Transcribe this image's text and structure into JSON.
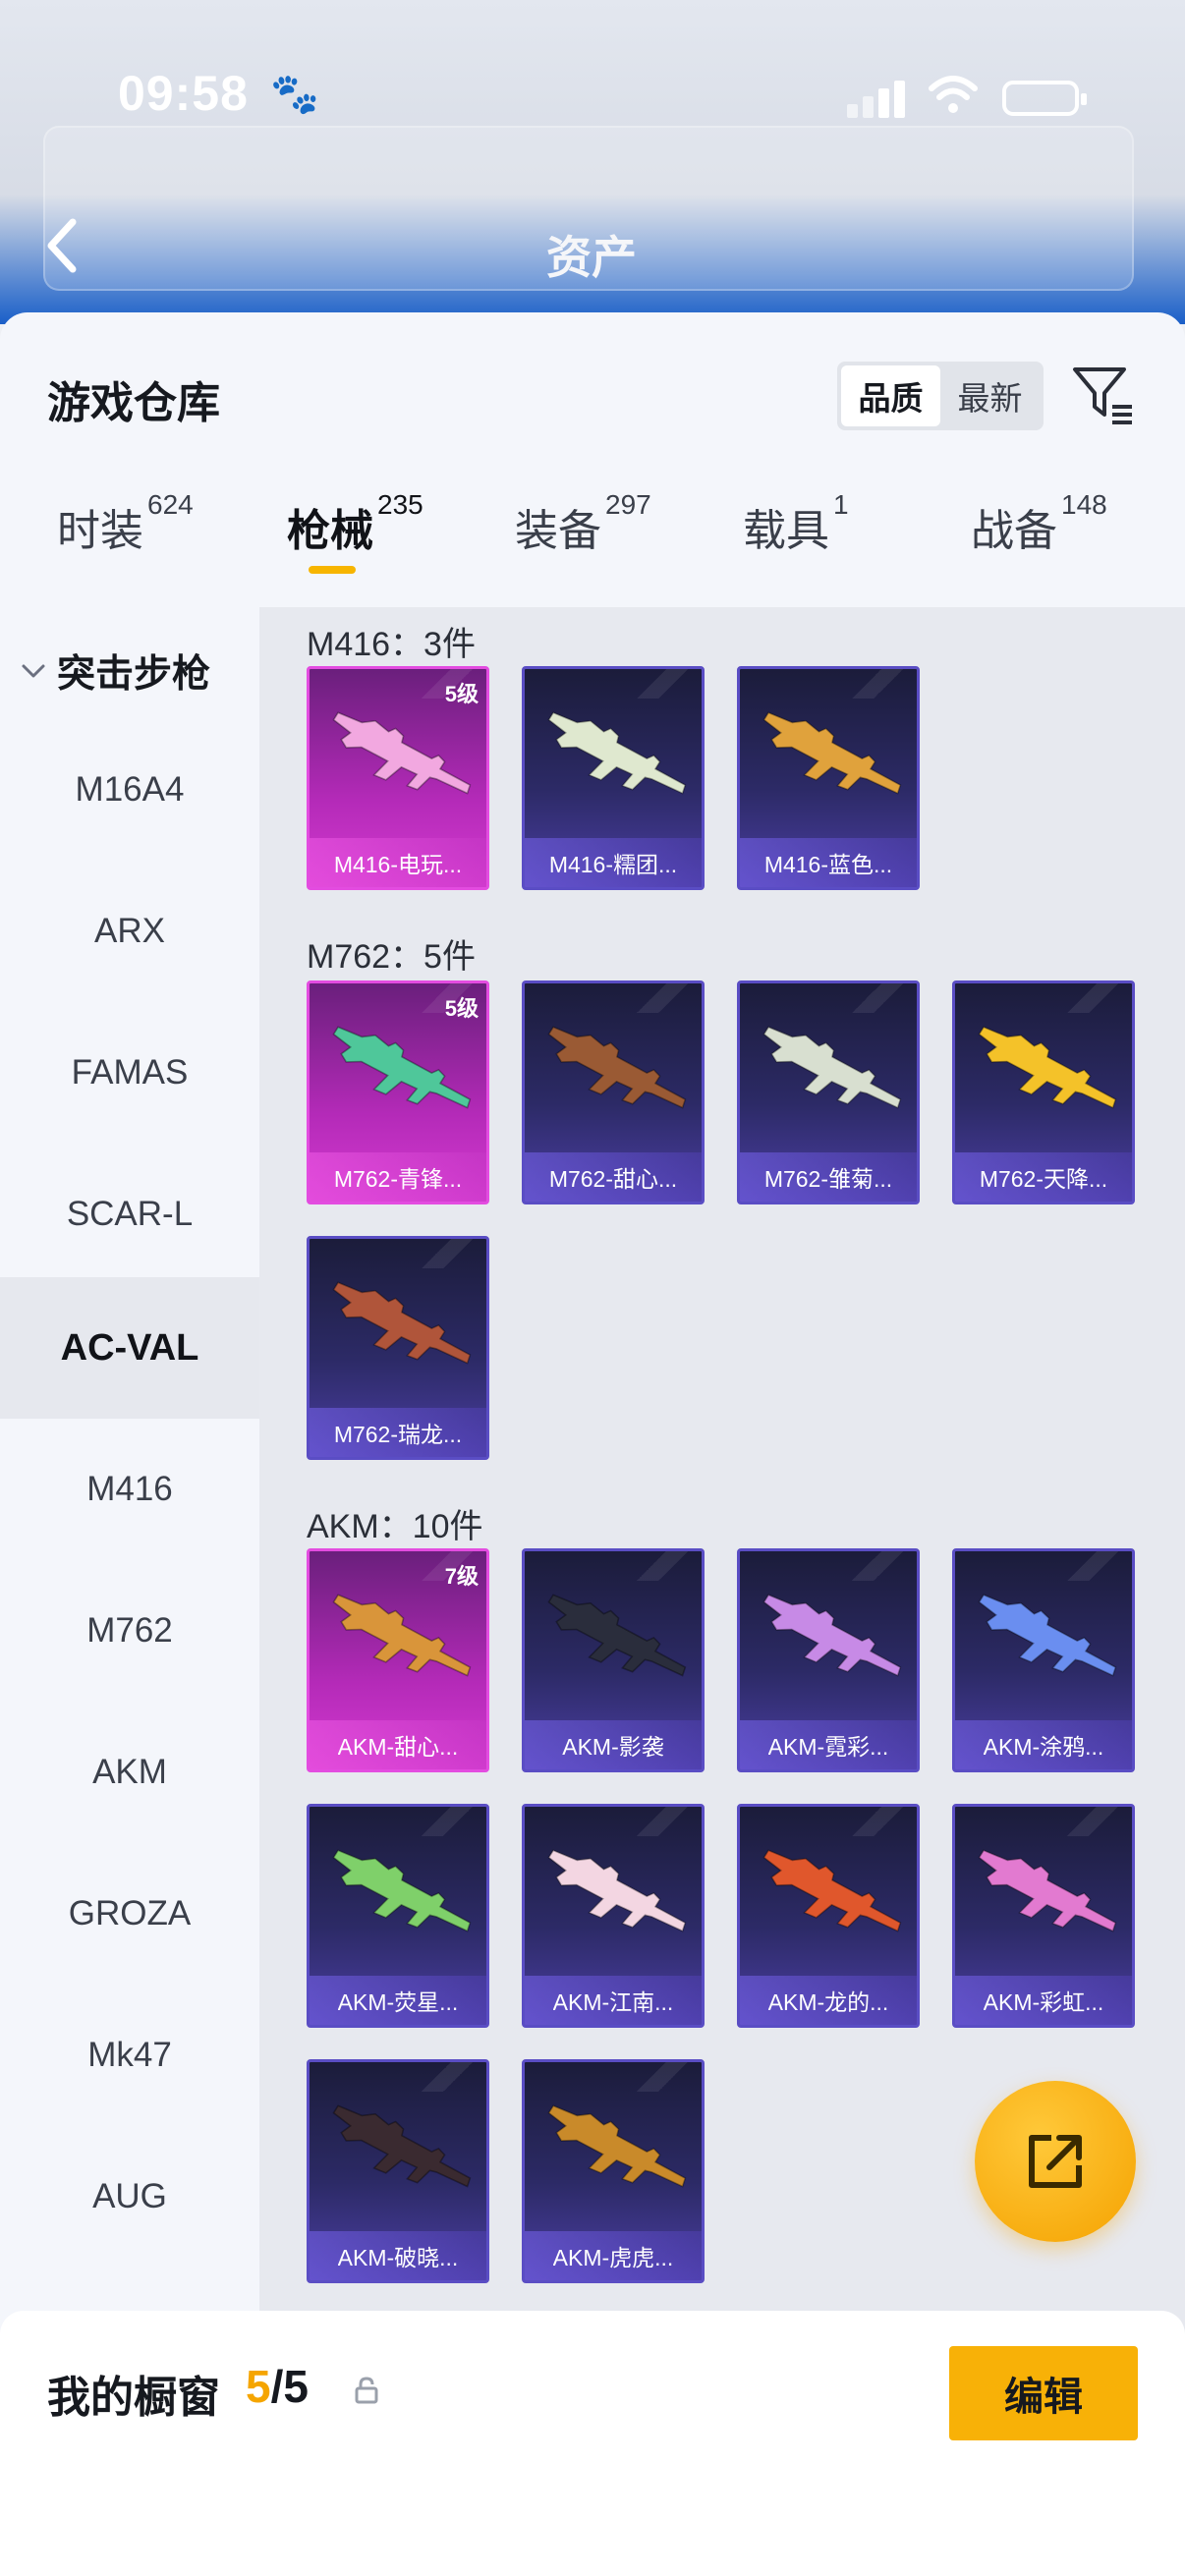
{
  "status_bar": {
    "time": "09:58"
  },
  "header": {
    "title": "资产"
  },
  "warehouse": {
    "title": "游戏仓库",
    "sort": {
      "quality": "品质",
      "newest": "最新"
    },
    "tabs": [
      {
        "label": "时装",
        "count": "624"
      },
      {
        "label": "枪械",
        "count": "235"
      },
      {
        "label": "装备",
        "count": "297"
      },
      {
        "label": "载具",
        "count": "1"
      },
      {
        "label": "战备",
        "count": "148"
      }
    ]
  },
  "sidebar": {
    "group": "突击步枪",
    "items": [
      "M16A4",
      "ARX",
      "FAMAS",
      "SCAR-L",
      "AC-VAL",
      "M416",
      "M762",
      "AKM",
      "GROZA",
      "Mk47",
      "AUG"
    ],
    "active": "AC-VAL"
  },
  "groups": [
    {
      "title": "M416：3件",
      "items": [
        {
          "label": "M416-电玩...",
          "level": "5级",
          "rarity": "pink",
          "gun_color": "#f2a8e0"
        },
        {
          "label": "M416-糯团...",
          "level": "",
          "rarity": "purple",
          "gun_color": "#dfe8cf"
        },
        {
          "label": "M416-蓝色...",
          "level": "",
          "rarity": "purple",
          "gun_color": "#e0a23c"
        }
      ]
    },
    {
      "title": "M762：5件",
      "items": [
        {
          "label": "M762-青锋...",
          "level": "5级",
          "rarity": "pink",
          "gun_color": "#4fc79a"
        },
        {
          "label": "M762-甜心...",
          "level": "",
          "rarity": "purple",
          "gun_color": "#9a5a34"
        },
        {
          "label": "M762-雏菊...",
          "level": "",
          "rarity": "purple",
          "gun_color": "#d8dfd0"
        },
        {
          "label": "M762-天降...",
          "level": "",
          "rarity": "purple",
          "gun_color": "#f4c229"
        },
        {
          "label": "M762-瑞龙...",
          "level": "",
          "rarity": "purple",
          "gun_color": "#b0553a"
        }
      ]
    },
    {
      "title": "AKM：10件",
      "items": [
        {
          "label": "AKM-甜心...",
          "level": "7级",
          "rarity": "pink",
          "gun_color": "#d9953a"
        },
        {
          "label": "AKM-影袭",
          "level": "",
          "rarity": "purple",
          "gun_color": "#2a2d3c"
        },
        {
          "label": "AKM-霓彩...",
          "level": "",
          "rarity": "purple",
          "gun_color": "#c78ae6"
        },
        {
          "label": "AKM-涂鸦...",
          "level": "",
          "rarity": "purple",
          "gun_color": "#6a8ef0"
        },
        {
          "label": "AKM-荧星...",
          "level": "",
          "rarity": "purple",
          "gun_color": "#7fd06a"
        },
        {
          "label": "AKM-江南...",
          "level": "",
          "rarity": "purple",
          "gun_color": "#f3d6e2"
        },
        {
          "label": "AKM-龙的...",
          "level": "",
          "rarity": "purple",
          "gun_color": "#e0572c"
        },
        {
          "label": "AKM-彩虹...",
          "level": "",
          "rarity": "purple",
          "gun_color": "#e27ad0"
        },
        {
          "label": "AKM-破晓...",
          "level": "",
          "rarity": "purple",
          "gun_color": "#3a2a30"
        },
        {
          "label": "AKM-虎虎...",
          "level": "",
          "rarity": "purple",
          "gun_color": "#c98a2a"
        }
      ]
    }
  ],
  "showcase": {
    "title": "我的橱窗",
    "current": "5",
    "sep": "/",
    "total": "5",
    "edit_label": "编辑"
  },
  "colors": {
    "accent": "#f7b500",
    "pink_card": "#d43ad0",
    "purple_card": "#4b3ea3"
  }
}
